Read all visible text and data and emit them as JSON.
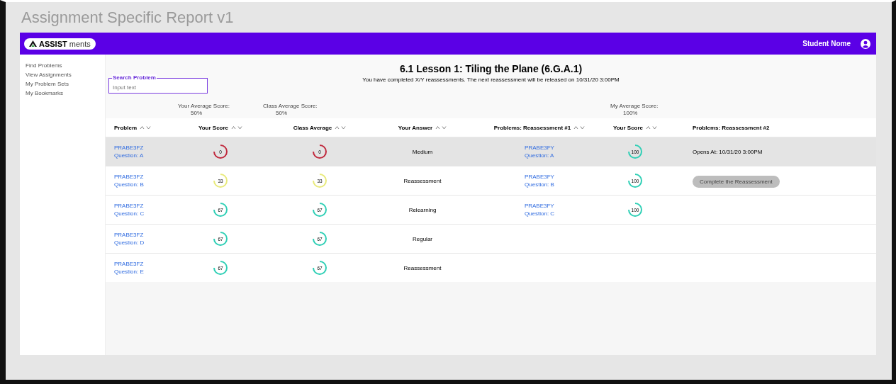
{
  "page_title": "Assignment Specific Report v1",
  "topbar": {
    "logo_bold": "ASSIST",
    "logo_rest": "ments",
    "user_name": "Student Nome"
  },
  "sidebar": {
    "items": [
      "Find Problems",
      "View Assignments",
      "My Problem Sets",
      "My Bookmarks"
    ]
  },
  "report": {
    "title": "6.1 Lesson 1: Tiling the Plane (6.G.A.1)",
    "subtitle": "You have completed X/Y reassessments. The next reassessment will be released on 10/31/20 3:00PM"
  },
  "search": {
    "label": "Search Problem",
    "placeholder": "Input text"
  },
  "averages": {
    "your_score": {
      "label": "Your Average Score:",
      "value": "50%"
    },
    "class_average": {
      "label": "Class Average Score:",
      "value": "50%"
    },
    "reassessment_score": {
      "label": "My Average Score:",
      "value": "100%"
    }
  },
  "columns": [
    {
      "label": "Problem",
      "sortable": true
    },
    {
      "label": "Your Score",
      "sortable": true
    },
    {
      "label": "Class Average",
      "sortable": true
    },
    {
      "label": "Your Answer",
      "sortable": true
    },
    {
      "label": "Problems: Reassessment #1",
      "sortable": true
    },
    {
      "label": "Your Score",
      "sortable": true
    },
    {
      "label": "Problems: Reassessment #2",
      "sortable": false
    }
  ],
  "rows": [
    {
      "selected": true,
      "problem": [
        "PRABE3FZ",
        "Question: A"
      ],
      "your_score": {
        "value": "0",
        "color": "#c0283c"
      },
      "class_average": {
        "value": "0",
        "color": "#c0283c"
      },
      "answer": "Medium",
      "reassessment_1": {
        "problem": [
          "PRABE3FY",
          "Question: A"
        ],
        "score": {
          "value": "100",
          "color": "#2ecfb5"
        }
      },
      "reassessment_2": {
        "kind": "text",
        "text": "Opens At: 10/31/20 3:00PM"
      }
    },
    {
      "selected": false,
      "problem": [
        "PRABE3FZ",
        "Question: B"
      ],
      "your_score": {
        "value": "33",
        "color": "#e8ea7a"
      },
      "class_average": {
        "value": "33",
        "color": "#e8ea7a"
      },
      "answer": "Reassessment",
      "reassessment_1": {
        "problem": [
          "PRABE3FY",
          "Question: B"
        ],
        "score": {
          "value": "100",
          "color": "#2ecfb5"
        }
      },
      "reassessment_2": {
        "kind": "button",
        "text": "Complete the Reassessment"
      }
    },
    {
      "selected": false,
      "problem": [
        "PRABE3FZ",
        "Question: C"
      ],
      "your_score": {
        "value": "67",
        "color": "#2ecfb5"
      },
      "class_average": {
        "value": "67",
        "color": "#2ecfb5"
      },
      "answer": "Relearning",
      "reassessment_1": {
        "problem": [
          "PRABE3FY",
          "Question: C"
        ],
        "score": {
          "value": "100",
          "color": "#2ecfb5"
        }
      }
    },
    {
      "selected": false,
      "problem": [
        "PRABE3FZ",
        "Question: D"
      ],
      "your_score": {
        "value": "67",
        "color": "#2ecfb5"
      },
      "class_average": {
        "value": "67",
        "color": "#2ecfb5"
      },
      "answer": "Regular"
    },
    {
      "selected": false,
      "problem": [
        "PRABE3FZ",
        "Question: E"
      ],
      "your_score": {
        "value": "67",
        "color": "#2ecfb5"
      },
      "class_average": {
        "value": "67",
        "color": "#2ecfb5"
      },
      "answer": "Reassessment"
    }
  ]
}
